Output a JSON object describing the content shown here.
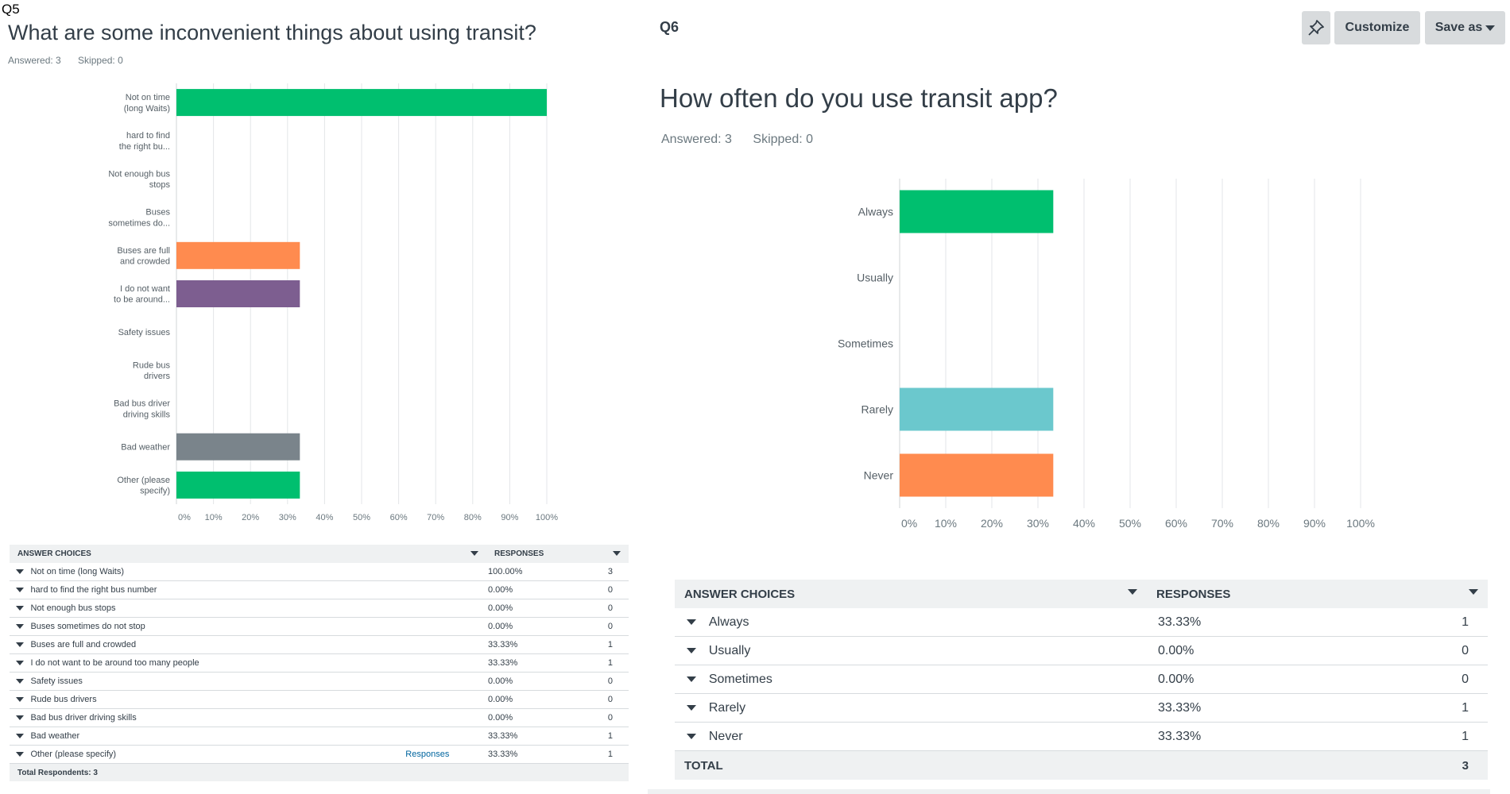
{
  "q5": {
    "tag": "Q5",
    "title": "What are some inconvenient things about using transit?",
    "answered": "Answered: 3",
    "skipped": "Skipped: 0",
    "table": {
      "col_choices": "ANSWER CHOICES",
      "col_responses": "RESPONSES",
      "rows": [
        {
          "label": "Not on time (long Waits)",
          "pct": "100.00%",
          "count": "3"
        },
        {
          "label": "hard to find the right bus number",
          "pct": "0.00%",
          "count": "0"
        },
        {
          "label": "Not enough bus stops",
          "pct": "0.00%",
          "count": "0"
        },
        {
          "label": "Buses sometimes do not stop",
          "pct": "0.00%",
          "count": "0"
        },
        {
          "label": "Buses are full and crowded",
          "pct": "33.33%",
          "count": "1"
        },
        {
          "label": "I do not want to be around too many people",
          "pct": "33.33%",
          "count": "1"
        },
        {
          "label": "Safety issues",
          "pct": "0.00%",
          "count": "0"
        },
        {
          "label": "Rude bus drivers",
          "pct": "0.00%",
          "count": "0"
        },
        {
          "label": "Bad bus driver driving skills",
          "pct": "0.00%",
          "count": "0"
        },
        {
          "label": "Bad weather",
          "pct": "33.33%",
          "count": "1"
        },
        {
          "label": "Other (please specify)",
          "pct": "33.33%",
          "count": "1",
          "link": "Responses"
        }
      ],
      "footer": "Total Respondents: 3"
    }
  },
  "q6": {
    "tag": "Q6",
    "title": "How often do you use transit app?",
    "answered": "Answered: 3",
    "skipped": "Skipped: 0",
    "table": {
      "col_choices": "ANSWER CHOICES",
      "col_responses": "RESPONSES",
      "rows": [
        {
          "label": "Always",
          "pct": "33.33%",
          "count": "1"
        },
        {
          "label": "Usually",
          "pct": "0.00%",
          "count": "0"
        },
        {
          "label": "Sometimes",
          "pct": "0.00%",
          "count": "0"
        },
        {
          "label": "Rarely",
          "pct": "33.33%",
          "count": "1"
        },
        {
          "label": "Never",
          "pct": "33.33%",
          "count": "1"
        }
      ],
      "footer_label": "TOTAL",
      "footer_value": "3"
    }
  },
  "toolbar": {
    "pin_icon": "pin-icon",
    "customize_label": "Customize",
    "save_as_label": "Save as"
  },
  "chart_data": [
    {
      "type": "bar",
      "orientation": "horizontal",
      "categories": [
        [
          "Not on time",
          "(long Waits)"
        ],
        [
          "hard to find",
          "the right bu..."
        ],
        [
          "Not enough bus",
          "stops"
        ],
        [
          "Buses",
          "sometimes do..."
        ],
        [
          "Buses are full",
          "and crowded"
        ],
        [
          "I do not want",
          "to be around..."
        ],
        [
          "Safety issues"
        ],
        [
          "Rude bus",
          "drivers"
        ],
        [
          "Bad bus driver",
          "driving skills"
        ],
        [
          "Bad weather"
        ],
        [
          "Other (please",
          "specify)"
        ]
      ],
      "values": [
        100,
        0,
        0,
        0,
        33.33,
        33.33,
        0,
        0,
        0,
        33.33,
        33.33
      ],
      "colors": [
        "#00bf6f",
        "#00bf6f",
        "#00bf6f",
        "#00bf6f",
        "#ff8b4f",
        "#7d5e90",
        "#00bf6f",
        "#00bf6f",
        "#00bf6f",
        "#7a848b",
        "#00bf6f"
      ],
      "xlim": [
        0,
        100
      ],
      "ticks": [
        "0%",
        "10%",
        "20%",
        "30%",
        "40%",
        "50%",
        "60%",
        "70%",
        "80%",
        "90%",
        "100%"
      ],
      "grid": true
    },
    {
      "type": "bar",
      "orientation": "horizontal",
      "categories": [
        [
          "Always"
        ],
        [
          "Usually"
        ],
        [
          "Sometimes"
        ],
        [
          "Rarely"
        ],
        [
          "Never"
        ]
      ],
      "values": [
        33.33,
        0,
        0,
        33.33,
        33.33
      ],
      "colors": [
        "#00bf6f",
        "#00bf6f",
        "#00bf6f",
        "#6bc8cd",
        "#ff8b4f"
      ],
      "xlim": [
        0,
        100
      ],
      "ticks": [
        "0%",
        "10%",
        "20%",
        "30%",
        "40%",
        "50%",
        "60%",
        "70%",
        "80%",
        "90%",
        "100%"
      ],
      "grid": true
    }
  ]
}
